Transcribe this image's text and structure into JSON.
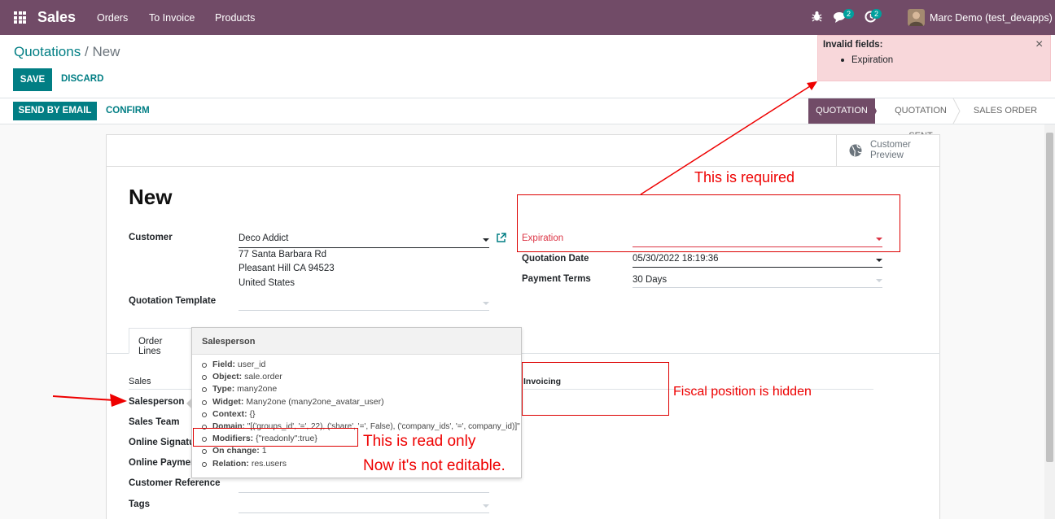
{
  "navbar": {
    "app_name": "Sales",
    "menu": [
      "Orders",
      "To Invoice",
      "Products"
    ],
    "chat_count": "2",
    "activity_count": "2",
    "user": "Marc Demo (test_devapps)"
  },
  "breadcrumb": {
    "parent": "Quotations",
    "separator": "/",
    "current": "New"
  },
  "actions": {
    "save": "SAVE",
    "discard": "DISCARD",
    "send_email": "SEND BY EMAIL",
    "confirm": "CONFIRM"
  },
  "stages": [
    "QUOTATION",
    "QUOTATION SENT",
    "SALES ORDER"
  ],
  "customer_preview": {
    "line1": "Customer",
    "line2": "Preview"
  },
  "form": {
    "title": "New",
    "customer_label": "Customer",
    "customer_value": "Deco Addict",
    "address": [
      "77 Santa Barbara Rd",
      "Pleasant Hill CA 94523",
      "United States"
    ],
    "template_label": "Quotation Template",
    "expiration_label": "Expiration",
    "quotation_date_label": "Quotation Date",
    "quotation_date_value": "05/30/2022 18:19:36",
    "payment_terms_label": "Payment Terms",
    "payment_terms_value": "30 Days"
  },
  "tabs": [
    "Order Lines"
  ],
  "other_info": {
    "sales_heading": "Sales",
    "invoicing_heading": "Invoicing",
    "labels": [
      "Salesperson",
      "Sales Team",
      "Online Signatu",
      "Online Paymen",
      "Customer Reference",
      "Tags"
    ]
  },
  "notification": {
    "title": "Invalid fields:",
    "items": [
      "Expiration"
    ],
    "close": "×"
  },
  "tooltip": {
    "title": "Salesperson",
    "rows": [
      {
        "k": "Field:",
        "v": "user_id"
      },
      {
        "k": "Object:",
        "v": "sale.order"
      },
      {
        "k": "Type:",
        "v": "many2one"
      },
      {
        "k": "Widget:",
        "v": "Many2one (many2one_avatar_user)"
      },
      {
        "k": "Context:",
        "v": "{}"
      },
      {
        "k": "Domain:",
        "v": "\"[('groups_id', '=', 22), ('share', '=', False), ('company_ids', '=', company_id)]\""
      },
      {
        "k": "Modifiers:",
        "v": "{\"readonly\":true}"
      },
      {
        "k": "On change:",
        "v": "1"
      },
      {
        "k": "Relation:",
        "v": "res.users"
      }
    ]
  },
  "annotations": {
    "required": "This is required",
    "fiscal": "Fiscal position is hidden",
    "readonly1": "This is read only",
    "readonly2": "Now it's not editable."
  },
  "colors": {
    "brand": "#714b67",
    "accent": "#017e84",
    "annotation": "#ee0000"
  }
}
